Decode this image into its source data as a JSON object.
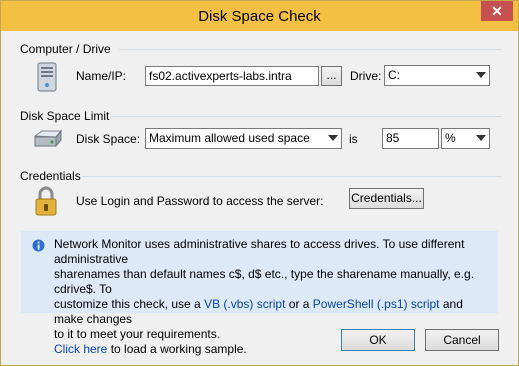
{
  "window": {
    "title": "Disk Space Check",
    "close_glyph": "✕"
  },
  "computer": {
    "group_label": "Computer / Drive",
    "name_label": "Name/IP:",
    "name_value": "fs02.activexperts-labs.intra",
    "browse_label": "...",
    "drive_label": "Drive:",
    "drive_value": "C:"
  },
  "limit": {
    "group_label": "Disk Space Limit",
    "space_label": "Disk Space:",
    "mode_value": "Maximum allowed used space",
    "is_label": "is",
    "amount_value": "85",
    "unit_value": "%"
  },
  "credentials": {
    "group_label": "Credentials",
    "text": "Use Login and Password to access the server:",
    "button_label": "Credentials..."
  },
  "info": {
    "line1": "Network Monitor uses administrative shares to access drives. To use different administrative",
    "line2": "sharenames than default names c$, d$ etc., type the sharename manually, e.g. cdrive$. To",
    "line3_a": "customize this check, use a ",
    "vb_link": "VB (.vbs) script",
    "line3_b": " or a ",
    "ps_link": "PowerShell (.ps1) script",
    "line3_c": " and make changes",
    "line4": "to it to meet your requirements.",
    "click_link": "Click here",
    "line5_b": " to load a working sample."
  },
  "buttons": {
    "ok": "OK",
    "cancel": "Cancel"
  },
  "colors": {
    "title_bar": "#f3c044",
    "info_bg": "#dde9f7",
    "link": "#0645ad"
  }
}
